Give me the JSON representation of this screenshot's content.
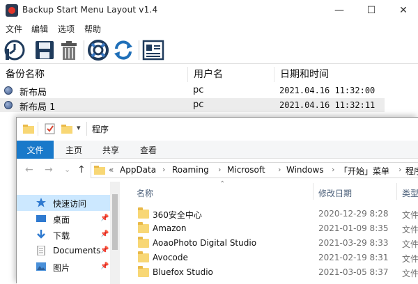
{
  "app": {
    "title": "Backup Start Menu Layout v1.4",
    "window_controls": {
      "minimize": "—",
      "maximize": "☐",
      "close": "✕"
    }
  },
  "menu": [
    "文件",
    "编辑",
    "选项",
    "帮助"
  ],
  "toolbar": {
    "buttons": [
      "backup-icon",
      "save-icon",
      "delete-icon",
      "restore-icon",
      "refresh-icon",
      "properties-icon"
    ]
  },
  "list": {
    "headers": [
      "备份名称",
      "用户名",
      "日期和时间"
    ],
    "rows": [
      {
        "name": "新布局",
        "user": "pc",
        "datetime": "2021.04.16 11:32:00"
      },
      {
        "name": "新布局 1",
        "user": "pc",
        "datetime": "2021.04.16 11:32:11",
        "selected": true
      }
    ]
  },
  "explorer": {
    "title": "程序",
    "quick_access_dropdown": "▾",
    "ribbon_tabs": [
      "文件",
      "主页",
      "共享",
      "查看"
    ],
    "nav_buttons": {
      "back": "←",
      "forward": "→",
      "down": "⌄",
      "up": "↑"
    },
    "address": {
      "prefix": "«",
      "crumbs": [
        "AppData",
        "Roaming",
        "Microsoft",
        "Windows",
        "「开始」菜单",
        "程序"
      ],
      "separator": "›"
    },
    "sort_indicator": "⌃",
    "pin_glyph": "📌",
    "nav_items": [
      {
        "label": "快速访问",
        "icon": "star-icon",
        "selected": true
      },
      {
        "label": "桌面",
        "icon": "desktop-icon",
        "pinned": true
      },
      {
        "label": "下载",
        "icon": "download-icon",
        "pinned": true
      },
      {
        "label": "Documents",
        "icon": "documents-icon",
        "pinned": true
      },
      {
        "label": "图片",
        "icon": "pictures-icon",
        "pinned": true
      }
    ],
    "columns": [
      "名称",
      "修改日期",
      "类型"
    ],
    "files": [
      {
        "name": "360安全中心",
        "date": "2020-12-29 8:28",
        "type": "文件"
      },
      {
        "name": "Amazon",
        "date": "2021-01-09 8:35",
        "type": "文件"
      },
      {
        "name": "AoaoPhoto Digital Studio",
        "date": "2021-03-29 8:33",
        "type": "文件"
      },
      {
        "name": "Avocode",
        "date": "2021-02-19 8:31",
        "type": "文件"
      },
      {
        "name": "Bluefox Studio",
        "date": "2021-03-05 8:37",
        "type": "文件"
      }
    ]
  },
  "colors": {
    "file_tab": "#1979ca",
    "nav_selected": "#cce8ff",
    "list_selected": "#ececec",
    "folder": "#f8d775"
  }
}
